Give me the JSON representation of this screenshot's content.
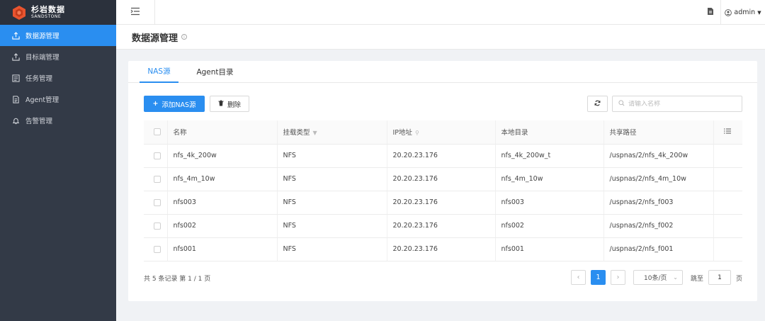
{
  "brand": {
    "name_cn": "杉岩数据",
    "name_en": "SANDSTONE"
  },
  "sidebar": {
    "items": [
      {
        "label": "数据源管理",
        "icon": "upload-tray-icon"
      },
      {
        "label": "目标端管理",
        "icon": "upload-tray-icon"
      },
      {
        "label": "任务管理",
        "icon": "task-list-icon"
      },
      {
        "label": "Agent管理",
        "icon": "document-icon"
      },
      {
        "label": "告警管理",
        "icon": "bell-icon"
      }
    ]
  },
  "header": {
    "user": "admin"
  },
  "page": {
    "title": "数据源管理"
  },
  "tabs": [
    {
      "label": "NAS源"
    },
    {
      "label": "Agent目录"
    }
  ],
  "toolbar": {
    "add_label": "添加NAS源",
    "delete_label": "删除",
    "search_placeholder": "请输入名称"
  },
  "table": {
    "columns": [
      "名称",
      "挂载类型",
      "IP地址",
      "本地目录",
      "共享路径"
    ],
    "rows": [
      {
        "name": "nfs_4k_200w",
        "type": "NFS",
        "ip": "20.20.23.176",
        "local": "nfs_4k_200w_t",
        "share": "/uspnas/2/nfs_4k_200w"
      },
      {
        "name": "nfs_4m_10w",
        "type": "NFS",
        "ip": "20.20.23.176",
        "local": "nfs_4m_10w",
        "share": "/uspnas/2/nfs_4m_10w"
      },
      {
        "name": "nfs003",
        "type": "NFS",
        "ip": "20.20.23.176",
        "local": "nfs003",
        "share": "/uspnas/2/nfs_f003"
      },
      {
        "name": "nfs002",
        "type": "NFS",
        "ip": "20.20.23.176",
        "local": "nfs002",
        "share": "/uspnas/2/nfs_f002"
      },
      {
        "name": "nfs001",
        "type": "NFS",
        "ip": "20.20.23.176",
        "local": "nfs001",
        "share": "/uspnas/2/nfs_f001"
      }
    ]
  },
  "pagination": {
    "summary": "共 5 条记录 第 1 / 1 页",
    "current_page": "1",
    "page_size": "10条/页",
    "jump_label": "跳至",
    "jump_value": "1",
    "page_suffix": "页"
  },
  "colors": {
    "accent": "#2a8ef0",
    "sidebar_bg": "#333a47"
  }
}
